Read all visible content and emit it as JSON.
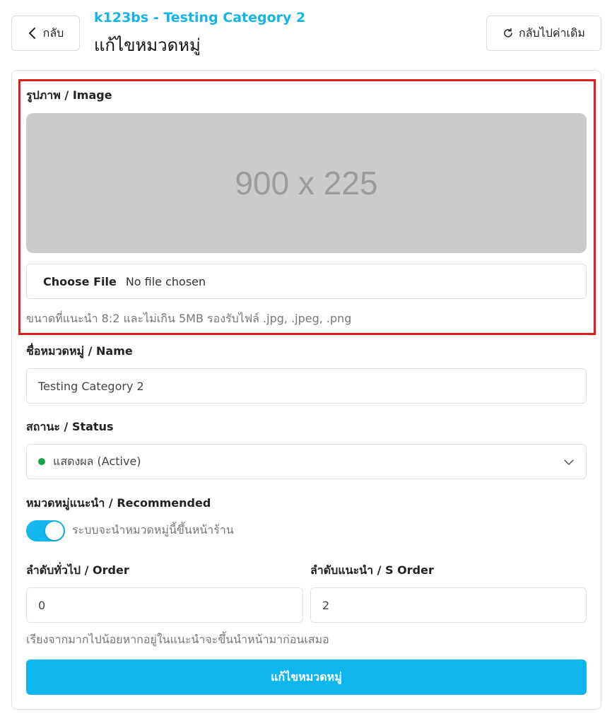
{
  "header": {
    "back_label": "กลับ",
    "subtitle": "k123bs - Testing Category 2",
    "title": "แก้ไขหมวดหมู่",
    "reset_label": "กลับไปค่าเดิม"
  },
  "image_section": {
    "label": "รูปภาพ / Image",
    "placeholder_text": "900 x 225",
    "choose_file_label": "Choose File",
    "file_status": "No file chosen",
    "help": "ขนาดที่แนะนำ 8:2 และไม่เกิน 5MB รองรับไฟล์ .jpg, .jpeg, .png"
  },
  "name_field": {
    "label": "ชื่อหมวดหมู่ / Name",
    "value": "Testing Category 2"
  },
  "status_field": {
    "label": "สถานะ / Status",
    "value": "แสดงผล (Active)",
    "dot_color": "#16a34a"
  },
  "recommended": {
    "label": "หมวดหมู่แนะนำ / Recommended",
    "toggle_on": true,
    "toggle_text": "ระบบจะนำหมวดหมู่นี้ขึ้นหน้าร้าน"
  },
  "order_field": {
    "label": "ลำดับทั่วไป / Order",
    "value": "0"
  },
  "s_order_field": {
    "label": "ลำดับแนะนำ / S Order",
    "value": "2"
  },
  "order_help": "เรียงจากมากไปน้อยหากอยู่ในแนะนำจะขึ้นนำหน้ามาก่อนเสมอ",
  "submit_label": "แก้ไขหมวดหมู่",
  "colors": {
    "accent": "#0fb6ee",
    "subtitle": "#14b4ea",
    "highlight": "#e21b1b"
  }
}
